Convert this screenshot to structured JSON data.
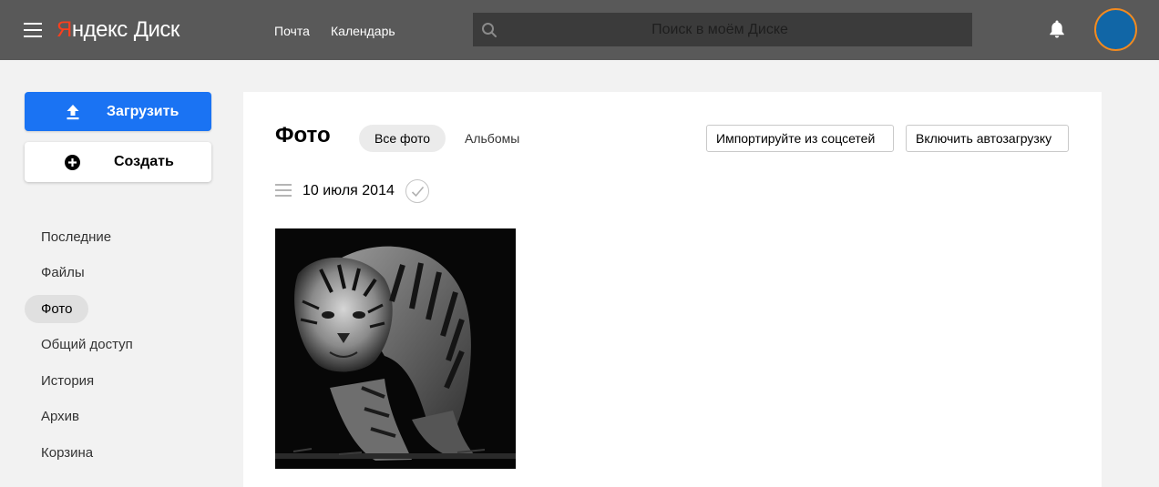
{
  "header": {
    "logo_first_letter": "Я",
    "logo_rest": "ндекс",
    "logo_service": "Диск",
    "links": [
      "Почта",
      "Календарь"
    ],
    "search_placeholder": "Поиск в моём Диске"
  },
  "sidebar": {
    "upload_label": "Загрузить",
    "create_label": "Создать",
    "items": [
      {
        "label": "Последние",
        "active": false
      },
      {
        "label": "Файлы",
        "active": false
      },
      {
        "label": "Фото",
        "active": true
      },
      {
        "label": "Общий доступ",
        "active": false
      },
      {
        "label": "История",
        "active": false
      },
      {
        "label": "Архив",
        "active": false
      },
      {
        "label": "Корзина",
        "active": false
      }
    ]
  },
  "main": {
    "title": "Фото",
    "tabs": [
      {
        "label": "Все фото",
        "active": true
      },
      {
        "label": "Альбомы",
        "active": false
      }
    ],
    "actions": {
      "import_label": "Импортируйте из соцсетей",
      "autoload_label": "Включить автозагрузку"
    },
    "groups": [
      {
        "date": "10 июля 2014",
        "photos": [
          {
            "subject": "tiger"
          }
        ]
      }
    ]
  },
  "colors": {
    "header_bg": "#595959",
    "accent_blue": "#1a73f3",
    "logo_red": "#fc3f1d",
    "avatar_fill": "#1166a6",
    "avatar_ring": "#f18a20"
  },
  "icons": [
    "menu-icon",
    "search-icon",
    "bell-icon",
    "upload-icon",
    "plus-circle-icon",
    "group-list-icon",
    "check-icon"
  ]
}
